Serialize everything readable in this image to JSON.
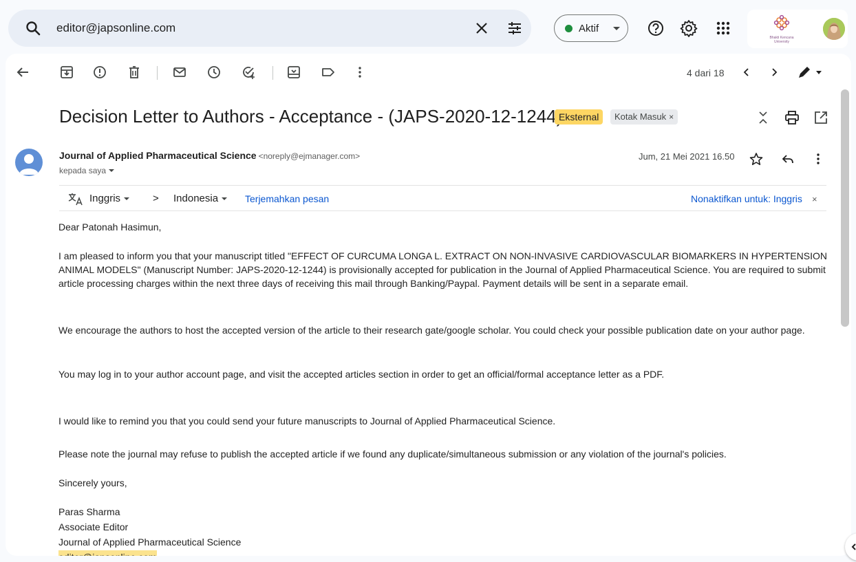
{
  "search": {
    "query": "editor@japsonline.com"
  },
  "status": {
    "label": "Aktif",
    "color": "#1e8e3e"
  },
  "account": {
    "org_caption": "Bhakti Kencana University"
  },
  "toolbar": {
    "pager": "4 dari 18"
  },
  "email": {
    "subject": "Decision Letter to Authors - Acceptance - (JAPS-2020-12-1244)",
    "labels": {
      "external": "Eksternal",
      "inbox": "Kotak Masuk",
      "inbox_remove": "×"
    },
    "sender_name": "Journal of Applied Pharmaceutical Science",
    "sender_email": "<noreply@ejmanager.com>",
    "recipient": "kepada saya",
    "date": "Jum, 21 Mei 2021 16.50"
  },
  "translate": {
    "source": "Inggris",
    "arrow": ">",
    "target": "Indonesia",
    "action": "Terjemahkan pesan",
    "disable": "Nonaktifkan untuk: Inggris",
    "disable_close": "×"
  },
  "body": {
    "greeting": "Dear Patonah Hasimun,",
    "p1": "I am pleased to inform you that your manuscript titled \"EFFECT OF CURCUMA LONGA L. EXTRACT ON NON-INVASIVE CARDIOVASCULAR BIOMARKERS IN HYPERTENSION ANIMAL MODELS\" (Manuscript Number: JAPS-2020-12-1244) is provisionally accepted for publication in the Journal of Applied Pharmaceutical Science. You are required to submit article processing charges within the next three days of receiving this mail through Banking/Paypal. Payment details will be sent in a separate email.",
    "p2": "We encourage the authors to host the accepted version of the article to their research gate/google scholar. You could check your possible publication date on your author page.",
    "p3": "You may log in to your author account page, and visit the accepted articles section in order to get an official/formal acceptance letter as a PDF.",
    "p4": "I would like to remind you that you could send your future manuscripts to Journal of Applied Pharmaceutical Science.",
    "p5": "Please note the journal may refuse to publish the accepted article if we found any duplicate/simultaneous submission or any violation of the journal's policies.",
    "closing": "Sincerely yours,",
    "sig_name": "Paras Sharma",
    "sig_title": "Associate Editor",
    "sig_org": "Journal of Applied Pharmaceutical Science",
    "sig_email": "editor@japsonline.com"
  }
}
